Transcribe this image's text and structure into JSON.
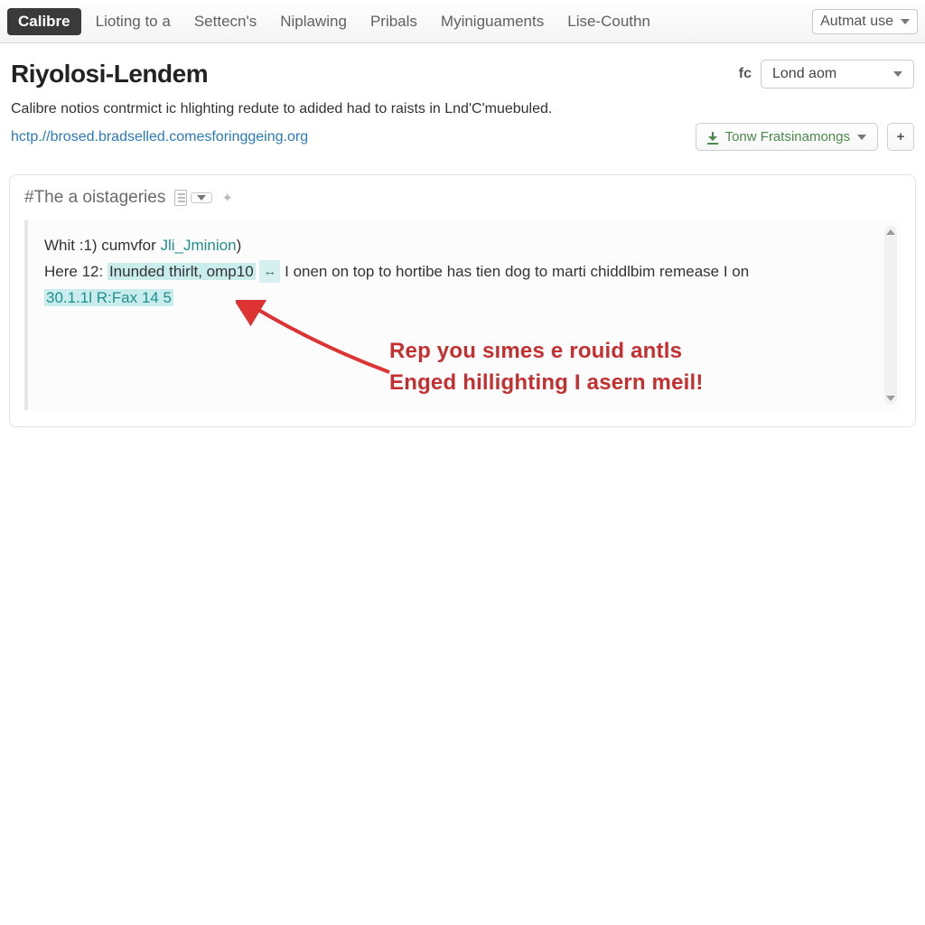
{
  "nav": {
    "brand": "Calibre",
    "items": [
      "Lioting to a",
      "Settecn's",
      "Niplawing",
      "Pribals",
      "Myiniguaments",
      "Lise-Couthn"
    ],
    "account_select": "Autmat use"
  },
  "header": {
    "title": "Riyolosi-Lendem",
    "right_label": "fc",
    "right_select": "Lond aom",
    "subtitle": "Calibre notios contrmict ic hlighting redute to adided had to raists in Lnd'C'muebuled.",
    "url": "hctp.//brosed.bradselled.comesforinggeing.org",
    "action_button": "Tonw Fratsinamongs",
    "plus": "+"
  },
  "panel": {
    "title": "#The a oistageries"
  },
  "content": {
    "line1_a": "Whit :1) cumvfor ",
    "line1_b": "Jli_Jminion",
    "line1_c": ")",
    "line2_a": "Here 12: ",
    "line2_hl": "Inunded thirlt, omp10",
    "line2_tag": "↔",
    "line2_b": " I onen on top to hortibe has tien dog to marti chiddlbim remease I on",
    "line3_hl": "30.1.1l R:Fax 14 5"
  },
  "annotation": {
    "line1": "Rep you sımes e rouid antls",
    "line2": "Enged hillighting I asern meil!"
  }
}
